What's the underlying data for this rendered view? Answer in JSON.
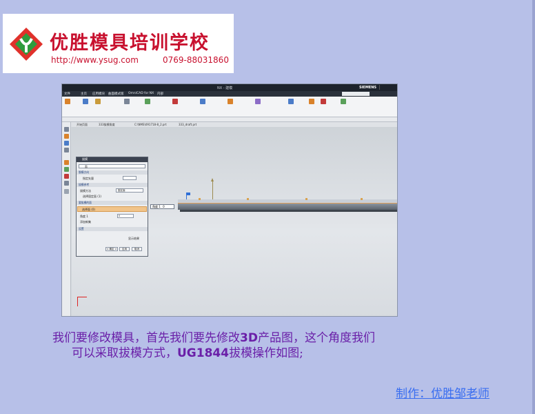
{
  "brand": {
    "title": "优胜模具培训学校",
    "url": "http://www.ysug.com",
    "phone": "0769-88031860",
    "logo_icon": "ysug-logo-icon"
  },
  "screenshot": {
    "window_title": "NX - 建模",
    "brand_label": "SIEMENS",
    "menus": [
      "文件",
      "主页",
      "应用模块",
      "曲面模式版",
      "OmniCAD for NX",
      "内部"
    ],
    "tabs": [
      "开始页面",
      "333拔模角度",
      "C:\\NMS\\091718-8_2.prt",
      "333_draft.prt"
    ],
    "dialog": {
      "title": "拔模",
      "type_value": "面",
      "section_draft_direction": "脱模方向",
      "specify_vector": "指定矢量",
      "section_draft_reference": "拔模参考",
      "draft_method_label": "拔模方法",
      "draft_method_value": "固定面",
      "select_fixed_face": "选择固定面 (1)",
      "section_faces_to_draft": "要拔模的面",
      "select_face": "选择面 (0)",
      "angle_label": "角度 1",
      "angle_value": "0",
      "add_new_set": "添加新集",
      "settings": "设置",
      "preview": "显示结果",
      "ok_button": "< 确定 >",
      "apply_button": "应用",
      "cancel_button": "取消"
    },
    "angle_callout_label": "角度 1",
    "angle_callout_value": "0"
  },
  "caption": {
    "line1_a": "我们要修改模具，首先我们要先修改",
    "line1_b": "3D",
    "line1_c": "产品图，这个角度我们",
    "line2_a": "可以采取拔模方式，",
    "line2_b": "UG1844",
    "line2_c": "拔模操作如图;"
  },
  "footer": {
    "author": "制作：优胜邹老师"
  },
  "colors": {
    "slide_bg": "#b7c0e8",
    "logo_red": "#c8102e",
    "caption_purple": "#6a1fa8",
    "footer_blue": "#3a6ef0"
  }
}
